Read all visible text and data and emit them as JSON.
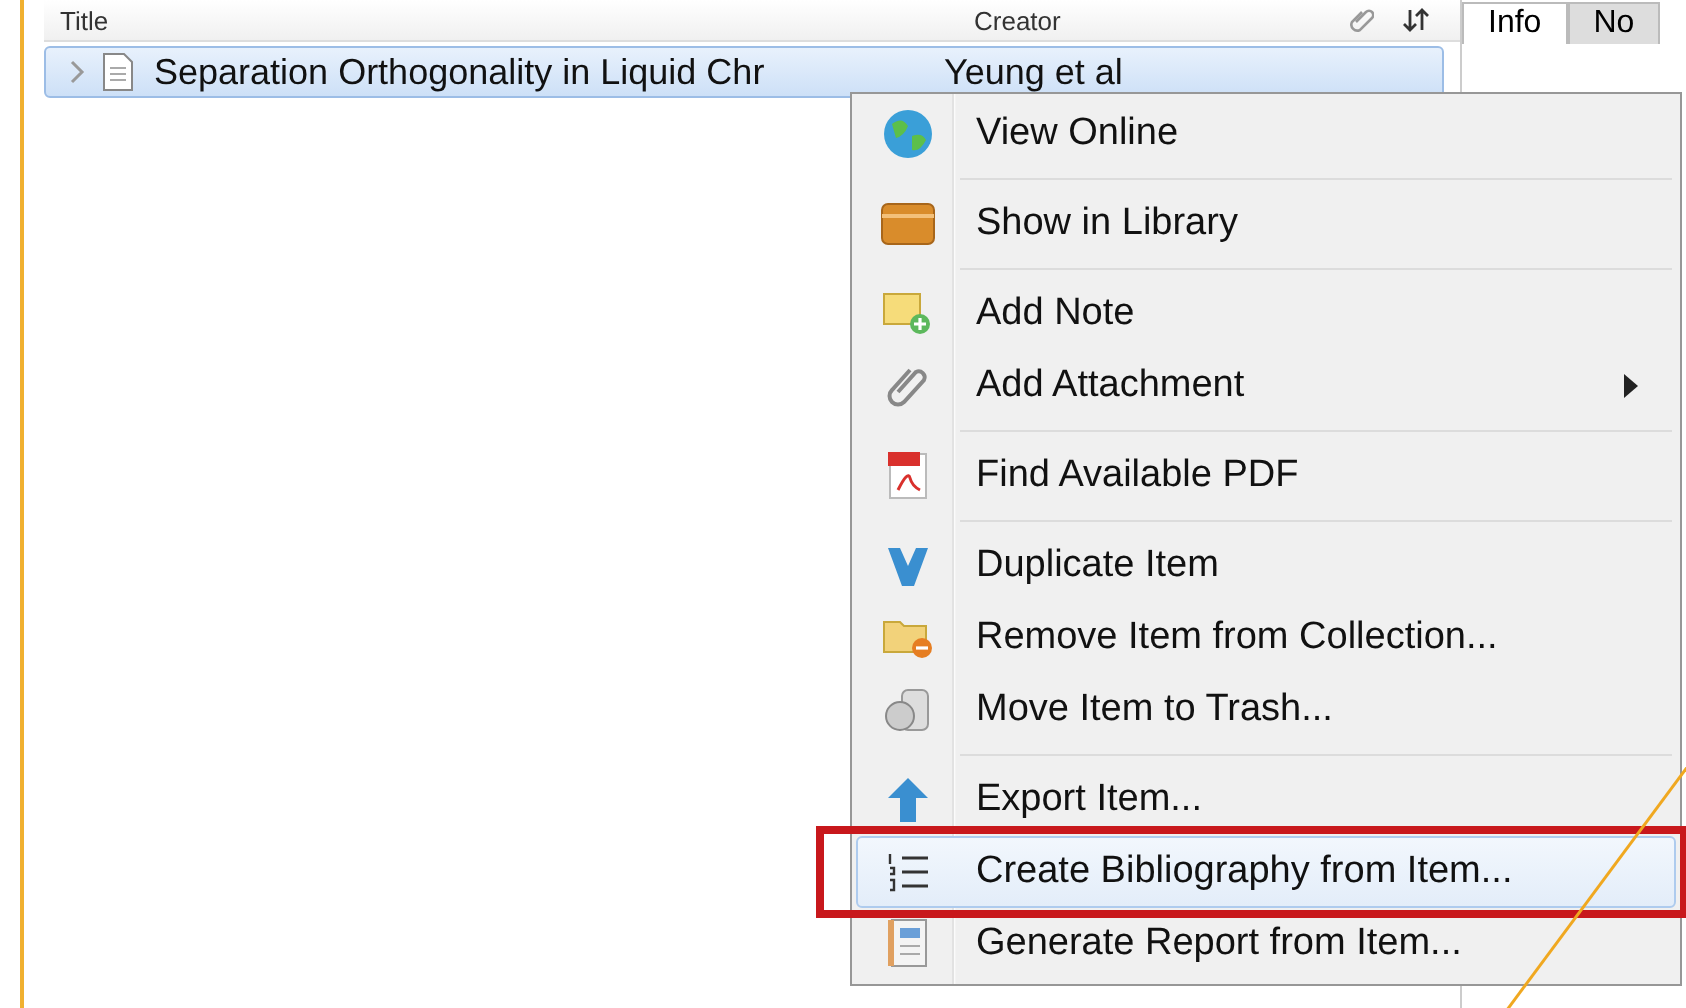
{
  "columns": [
    {
      "label": "Title"
    },
    {
      "label": "Creator"
    }
  ],
  "pane_tabs": [
    {
      "label": "Info",
      "selected": true
    },
    {
      "label": "No",
      "selected": false
    }
  ],
  "rows": [
    {
      "title": "Separation Orthogonality in Liquid Chr",
      "creator": "Yeung et al",
      "selected": true,
      "expanded": false
    }
  ],
  "context_menu": {
    "items": [
      {
        "kind": "item",
        "label": "View Online",
        "selected": false,
        "submenu": false
      },
      {
        "kind": "separator"
      },
      {
        "kind": "item",
        "label": "Show in Library",
        "selected": false,
        "submenu": false
      },
      {
        "kind": "separator"
      },
      {
        "kind": "item",
        "label": "Add Note",
        "selected": false,
        "submenu": false
      },
      {
        "kind": "item",
        "label": "Add Attachment",
        "selected": false,
        "submenu": true
      },
      {
        "kind": "separator"
      },
      {
        "kind": "item",
        "label": "Find Available PDF",
        "selected": false,
        "submenu": false
      },
      {
        "kind": "separator"
      },
      {
        "kind": "item",
        "label": "Duplicate Item",
        "selected": false,
        "submenu": false
      },
      {
        "kind": "item",
        "label": "Remove Item from Collection...",
        "selected": false,
        "submenu": false
      },
      {
        "kind": "item",
        "label": "Move Item to Trash...",
        "selected": false,
        "submenu": false
      },
      {
        "kind": "separator"
      },
      {
        "kind": "item",
        "label": "Export Item...",
        "selected": false,
        "submenu": false
      },
      {
        "kind": "item",
        "label": "Create Bibliography from Item...",
        "selected": true,
        "submenu": false,
        "highlighted": true
      },
      {
        "kind": "item",
        "label": "Generate Report from Item...",
        "selected": false,
        "submenu": false
      }
    ]
  }
}
